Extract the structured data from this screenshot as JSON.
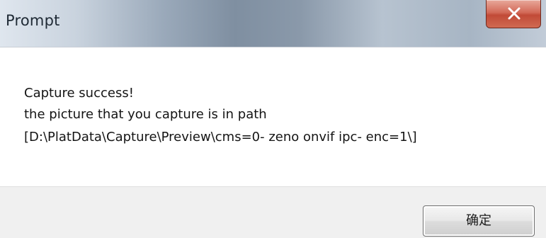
{
  "window": {
    "title": "Prompt",
    "close_icon": "close-x-icon"
  },
  "message": {
    "line1": "Capture success!",
    "line2": "the picture that you capture is in path",
    "line3": "[D:\\PlatData\\Capture\\Preview\\cms=0- zeno onvif ipc- enc=1\\]"
  },
  "buttons": {
    "ok_label": "确定"
  }
}
